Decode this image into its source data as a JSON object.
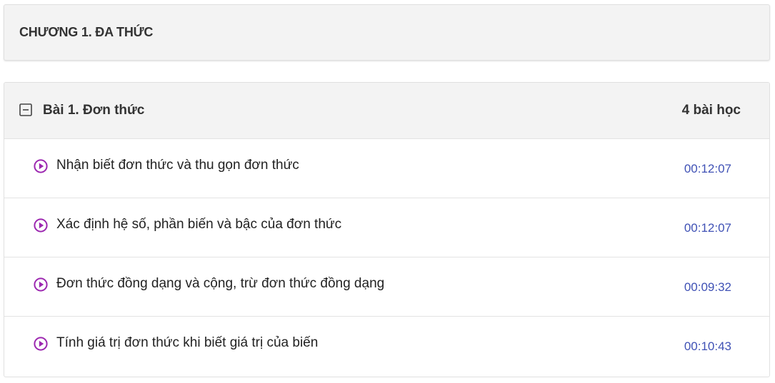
{
  "chapter": {
    "title": "CHƯƠNG 1. ĐA THỨC"
  },
  "lesson": {
    "title": "Bài 1. Đơn thức",
    "count_label": "4 bài học",
    "toggle_icon": "minus-square-icon",
    "items": [
      {
        "title": "Nhận biết đơn thức và thu gọn đơn thức",
        "duration": "00:12:07",
        "icon": "play-circle-icon"
      },
      {
        "title": "Xác định hệ số, phần biến và bậc của đơn thức",
        "duration": "00:12:07",
        "icon": "play-circle-icon"
      },
      {
        "title": "Đơn thức đồng dạng và cộng, trừ đơn thức đồng dạng",
        "duration": "00:09:32",
        "icon": "play-circle-icon"
      },
      {
        "title": "Tính giá trị đơn thức khi biết giá trị của biến",
        "duration": "00:10:43",
        "icon": "play-circle-icon"
      }
    ]
  },
  "colors": {
    "play_icon": "#9c27b0",
    "duration_text": "#3f51b5",
    "header_bg": "#f3f3f3",
    "border": "#e0e0e0"
  }
}
